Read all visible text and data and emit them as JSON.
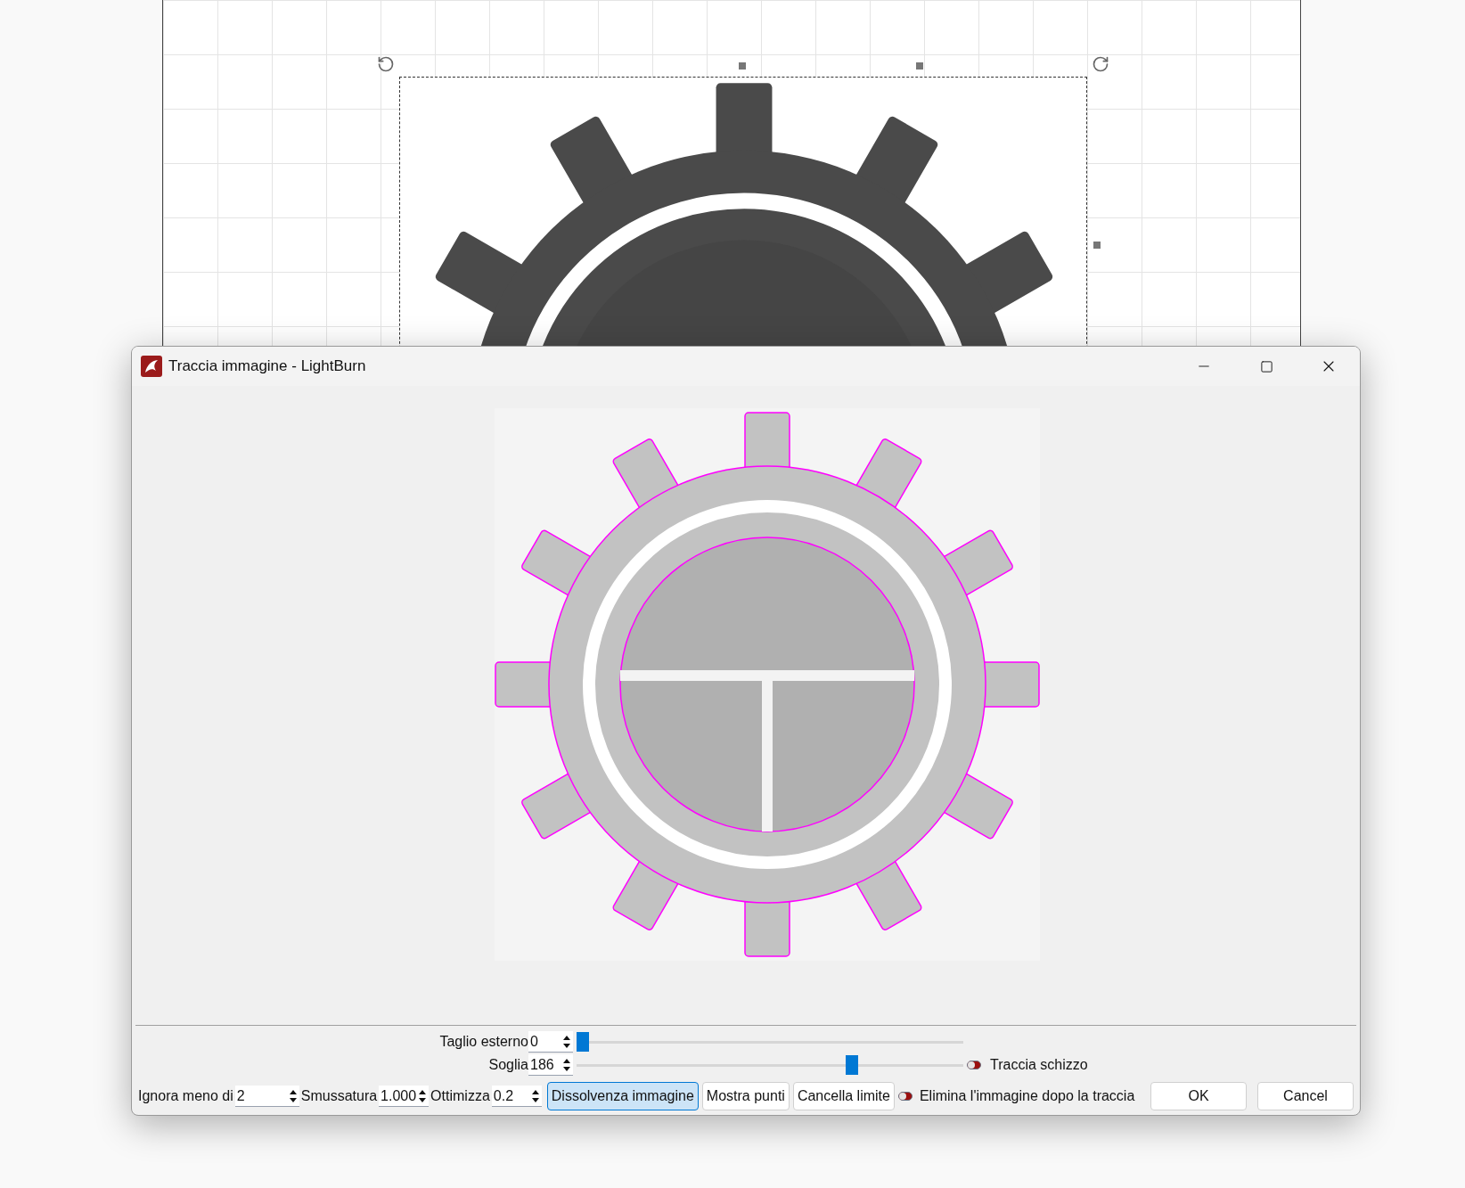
{
  "dialog": {
    "title": "Traccia immagine - LightBurn"
  },
  "sliders": [
    {
      "label": "Taglio esterno",
      "value": "0",
      "level": 0.0
    },
    {
      "label": "Soglia",
      "value": "186",
      "level": 0.72
    }
  ],
  "sketch_toggle": {
    "label": "Traccia schizzo",
    "on": false
  },
  "fields": [
    {
      "label": "Ignora meno di",
      "value": "2"
    },
    {
      "label": "Smussatura",
      "value": "1.000"
    },
    {
      "label": "Ottimizza",
      "value": "0.2"
    }
  ],
  "tool_buttons": [
    {
      "label": "Dissolvenza immagine",
      "selected": true
    },
    {
      "label": "Mostra punti",
      "selected": false
    },
    {
      "label": "Cancella limite",
      "selected": false
    }
  ],
  "delete_toggle": {
    "label": "Elimina l'immagine dopo la traccia",
    "on": false
  },
  "buttons": [
    "OK",
    "Cancel"
  ]
}
